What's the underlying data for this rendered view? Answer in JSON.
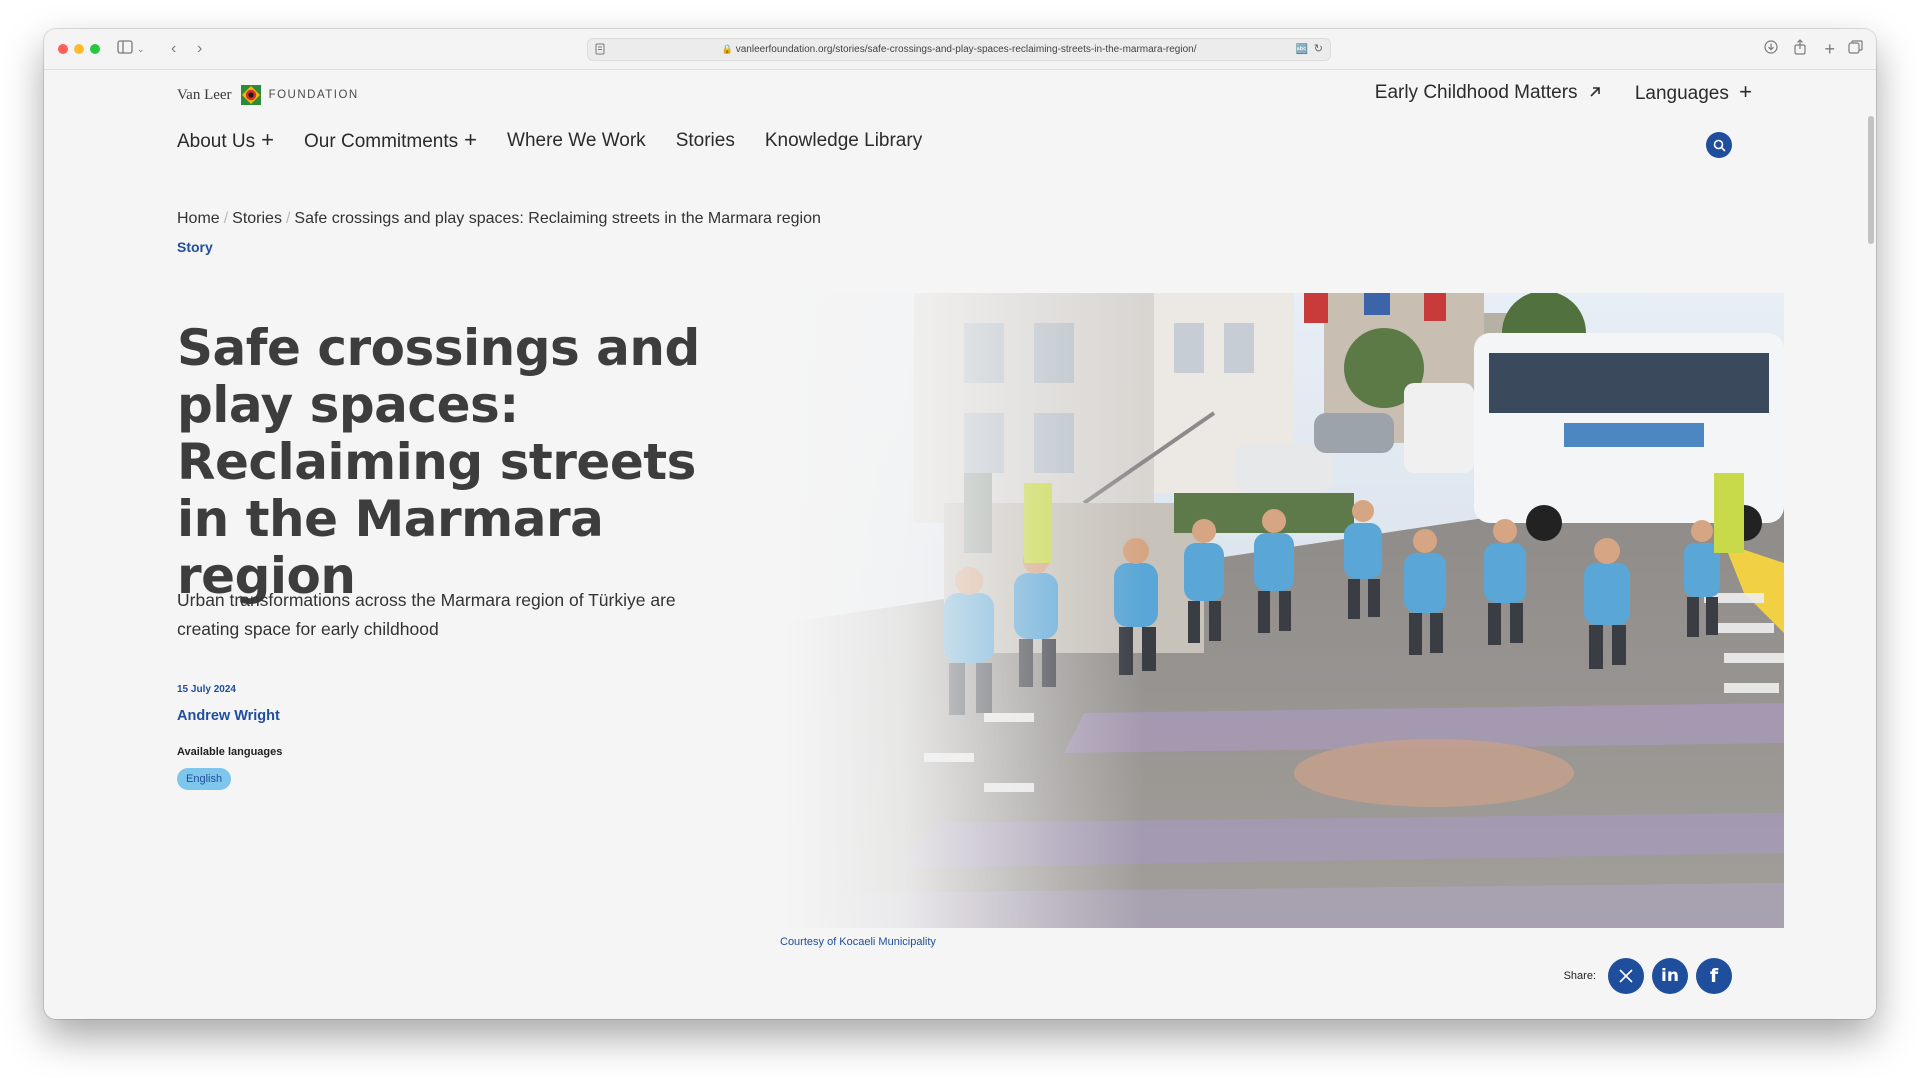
{
  "browser": {
    "url": "vanleerfoundation.org/stories/safe-crossings-and-play-spaces-reclaiming-streets-in-the-marmara-region/"
  },
  "header": {
    "logo_brand": "Van Leer",
    "logo_suffix": "FOUNDATION",
    "early_childhood_link": "Early Childhood Matters",
    "languages_label": "Languages"
  },
  "nav": {
    "items": [
      {
        "label": "About Us",
        "has_submenu": true
      },
      {
        "label": "Our Commitments",
        "has_submenu": true
      },
      {
        "label": "Where We Work",
        "has_submenu": false
      },
      {
        "label": "Stories",
        "has_submenu": false
      },
      {
        "label": "Knowledge Library",
        "has_submenu": false
      }
    ]
  },
  "breadcrumb": {
    "home": "Home",
    "section": "Stories",
    "current": "Safe crossings and play spaces: Reclaiming streets in the Marmara region"
  },
  "article": {
    "tag": "Story",
    "title": "Safe crossings and play spaces: Reclaiming streets in the Marmara region",
    "lede": "Urban transformations across the Marmara region of Türkiye are creating space for early childhood",
    "date": "15 July 2024",
    "author": "Andrew Wright",
    "languages_label": "Available languages",
    "languages": [
      "English"
    ],
    "image_caption": "Courtesy of Kocaeli Municipality",
    "share_label": "Share:"
  },
  "icons": {
    "close": "window-close-icon",
    "minimize": "window-minimize-icon",
    "zoom": "window-zoom-icon",
    "sidebar": "sidebar-toggle-icon",
    "back": "back-arrow-icon",
    "forward": "forward-arrow-icon",
    "reader": "reader-mode-icon",
    "lock": "lock-icon",
    "translate": "translate-icon",
    "reload": "reload-icon",
    "download": "download-icon",
    "share": "share-icon",
    "new_tab": "new-tab-icon",
    "tabs": "tab-overview-icon",
    "external": "external-arrow-icon",
    "plus": "plus-icon",
    "search": "search-icon",
    "x": "x-logo-icon",
    "linkedin": "linkedin-logo-icon",
    "facebook": "facebook-logo-icon"
  },
  "colors": {
    "accent": "#1f4e9c",
    "pill": "#7ec6ec",
    "title_text": "#3d3d3d",
    "page_bg": "#f5f5f5"
  }
}
